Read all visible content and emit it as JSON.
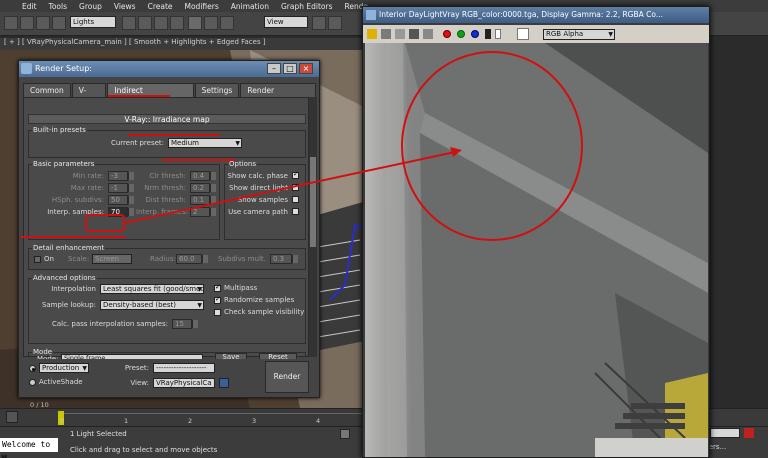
{
  "menubar": {
    "items": [
      "Edit",
      "Tools",
      "Group",
      "Views",
      "Create",
      "Modifiers",
      "Animation",
      "Graph Editors",
      "Rende"
    ]
  },
  "toolbar": {
    "selection_filter": "Lights",
    "ref_coord": "View"
  },
  "viewport": {
    "label": "[ + ] [ VRayPhysicalCamera_main ] [ Smooth + Highlights + Edged Faces ]"
  },
  "render_setup": {
    "title": "Render Setup:",
    "tabs": [
      "Common",
      "V-Ray",
      "Indirect illumination",
      "Settings",
      "Render Elements"
    ],
    "rollout_title": "V-Ray:: Irradiance map",
    "builtin_presets": {
      "group": "Built-in presets",
      "current_preset_label": "Current preset:",
      "current_preset_value": "Medium"
    },
    "basic": {
      "group": "Basic parameters",
      "min_rate_label": "Min rate:",
      "min_rate": "-3",
      "max_rate_label": "Max rate:",
      "max_rate": "-1",
      "hsph_label": "HSph. subdivs:",
      "hsph": "50",
      "interp_label": "Interp. samples:",
      "interp": "70",
      "clr_thresh_label": "Clr thresh:",
      "clr_thresh": "0.4",
      "nrm_thresh_label": "Nrm thresh:",
      "nrm_thresh": "0.2",
      "dist_thresh_label": "Dist thresh:",
      "dist_thresh": "0.1",
      "interp_frames_label": "Interp. frames:",
      "interp_frames": "2"
    },
    "options": {
      "group": "Options",
      "show_calc": "Show calc. phase",
      "show_direct": "Show direct light",
      "show_samples": "Show samples",
      "use_camera": "Use camera path"
    },
    "detail": {
      "group": "Detail enhancement",
      "on_label": "On",
      "scale_label": "Scale:",
      "scale_value": "Screen",
      "radius_label": "Radius:",
      "radius": "60.0",
      "subdivs_mult_label": "Subdivs mult.",
      "subdivs_mult": "0.3"
    },
    "advanced": {
      "group": "Advanced options",
      "interpolation_label": "Interpolation",
      "interpolation_value": "Least squares fit (good/smooth",
      "lookup_label": "Sample lookup:",
      "lookup_value": "Density-based (best)",
      "calc_pass_label": "Calc. pass interpolation samples:",
      "calc_pass": "15",
      "multipass": "Multipass",
      "randomize": "Randomize samples",
      "check_vis": "Check sample visibility"
    },
    "mode": {
      "group": "Mode",
      "mode_label": "Mode:",
      "mode_value": "Single frame",
      "save_label": "Save",
      "reset_label": "Reset"
    },
    "footer": {
      "production": "Production",
      "activeshade": "ActiveShade",
      "preset_label": "Preset:",
      "preset_value": "--------------------",
      "view_label": "View:",
      "view_value": "VRayPhysicalCa",
      "render_label": "Render"
    }
  },
  "frame_buffer": {
    "title": "Interior DayLightVray  RGB_color:0000.tga, Display Gamma: 2.2, RGBA Co...",
    "channel": "RGB Alpha"
  },
  "timeline": {
    "ticks": [
      "0",
      "1",
      "2",
      "3",
      "4"
    ],
    "frame_counter": "0 / 10"
  },
  "status": {
    "maxscript": "Welcome to M",
    "selected": "1 Light Selected",
    "prompt": "Click and drag to select and move objects",
    "right_field": "ters..."
  },
  "colors": {
    "annotation": "#d01010",
    "max_blue": "#4a6b93"
  }
}
